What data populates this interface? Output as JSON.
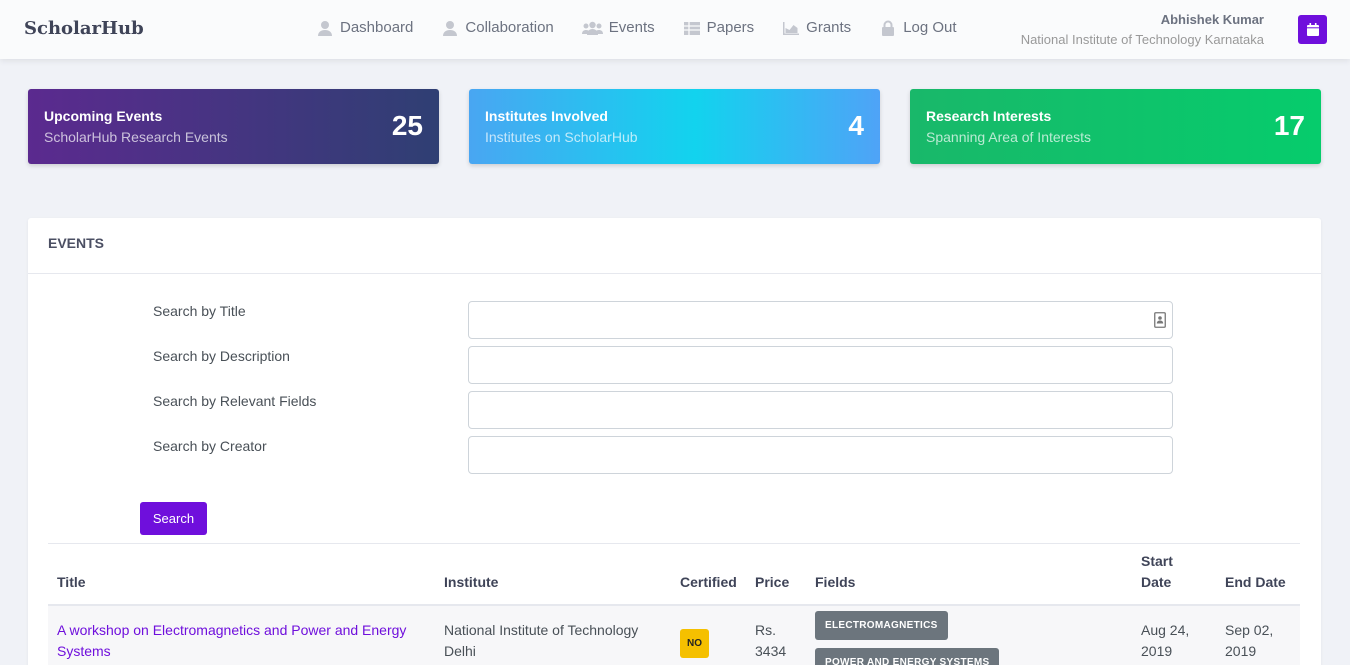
{
  "header": {
    "brand": "ScholarHub",
    "nav": [
      {
        "label": "Dashboard",
        "icon": "user-icon"
      },
      {
        "label": "Collaboration",
        "icon": "user-icon"
      },
      {
        "label": "Events",
        "icon": "users-icon"
      },
      {
        "label": "Papers",
        "icon": "table-icon"
      },
      {
        "label": "Grants",
        "icon": "chart-icon"
      },
      {
        "label": "Log Out",
        "icon": "lock-icon"
      }
    ],
    "user_name": "Abhishek Kumar",
    "user_institute": "National Institute of Technology Karnataka",
    "calendar_icon": "calendar-icon"
  },
  "cards": [
    {
      "title": "Upcoming Events",
      "subtitle": "ScholarHub Research Events",
      "value": "25"
    },
    {
      "title": "Institutes Involved",
      "subtitle": "Institutes on ScholarHub",
      "value": "4"
    },
    {
      "title": "Research Interests",
      "subtitle": "Spanning Area of Interests",
      "value": "17"
    }
  ],
  "events": {
    "heading": "EVENTS",
    "search_fields": [
      {
        "label": "Search by Title",
        "value": ""
      },
      {
        "label": "Search by Description",
        "value": ""
      },
      {
        "label": "Search by Relevant Fields",
        "value": ""
      },
      {
        "label": "Search by Creator",
        "value": ""
      }
    ],
    "search_button": "Search",
    "columns": [
      "Title",
      "Institute",
      "Certified",
      "Price",
      "Fields",
      "Start Date",
      "End Date"
    ],
    "rows": [
      {
        "title": "A workshop on Electromagnetics and Power and Energy Systems",
        "institute": "National Institute of Technology Delhi",
        "certified": "NO",
        "price": "Rs. 3434",
        "fields": [
          "ELECTROMAGNETICS",
          "POWER AND ENERGY SYSTEMS"
        ],
        "start_date": "Aug 24, 2019",
        "end_date": "Sep 02, 2019"
      }
    ]
  },
  "colors": {
    "accent": "#6f0fdc",
    "badge_warning": "#f5c000",
    "badge_secondary": "#6c757d"
  }
}
